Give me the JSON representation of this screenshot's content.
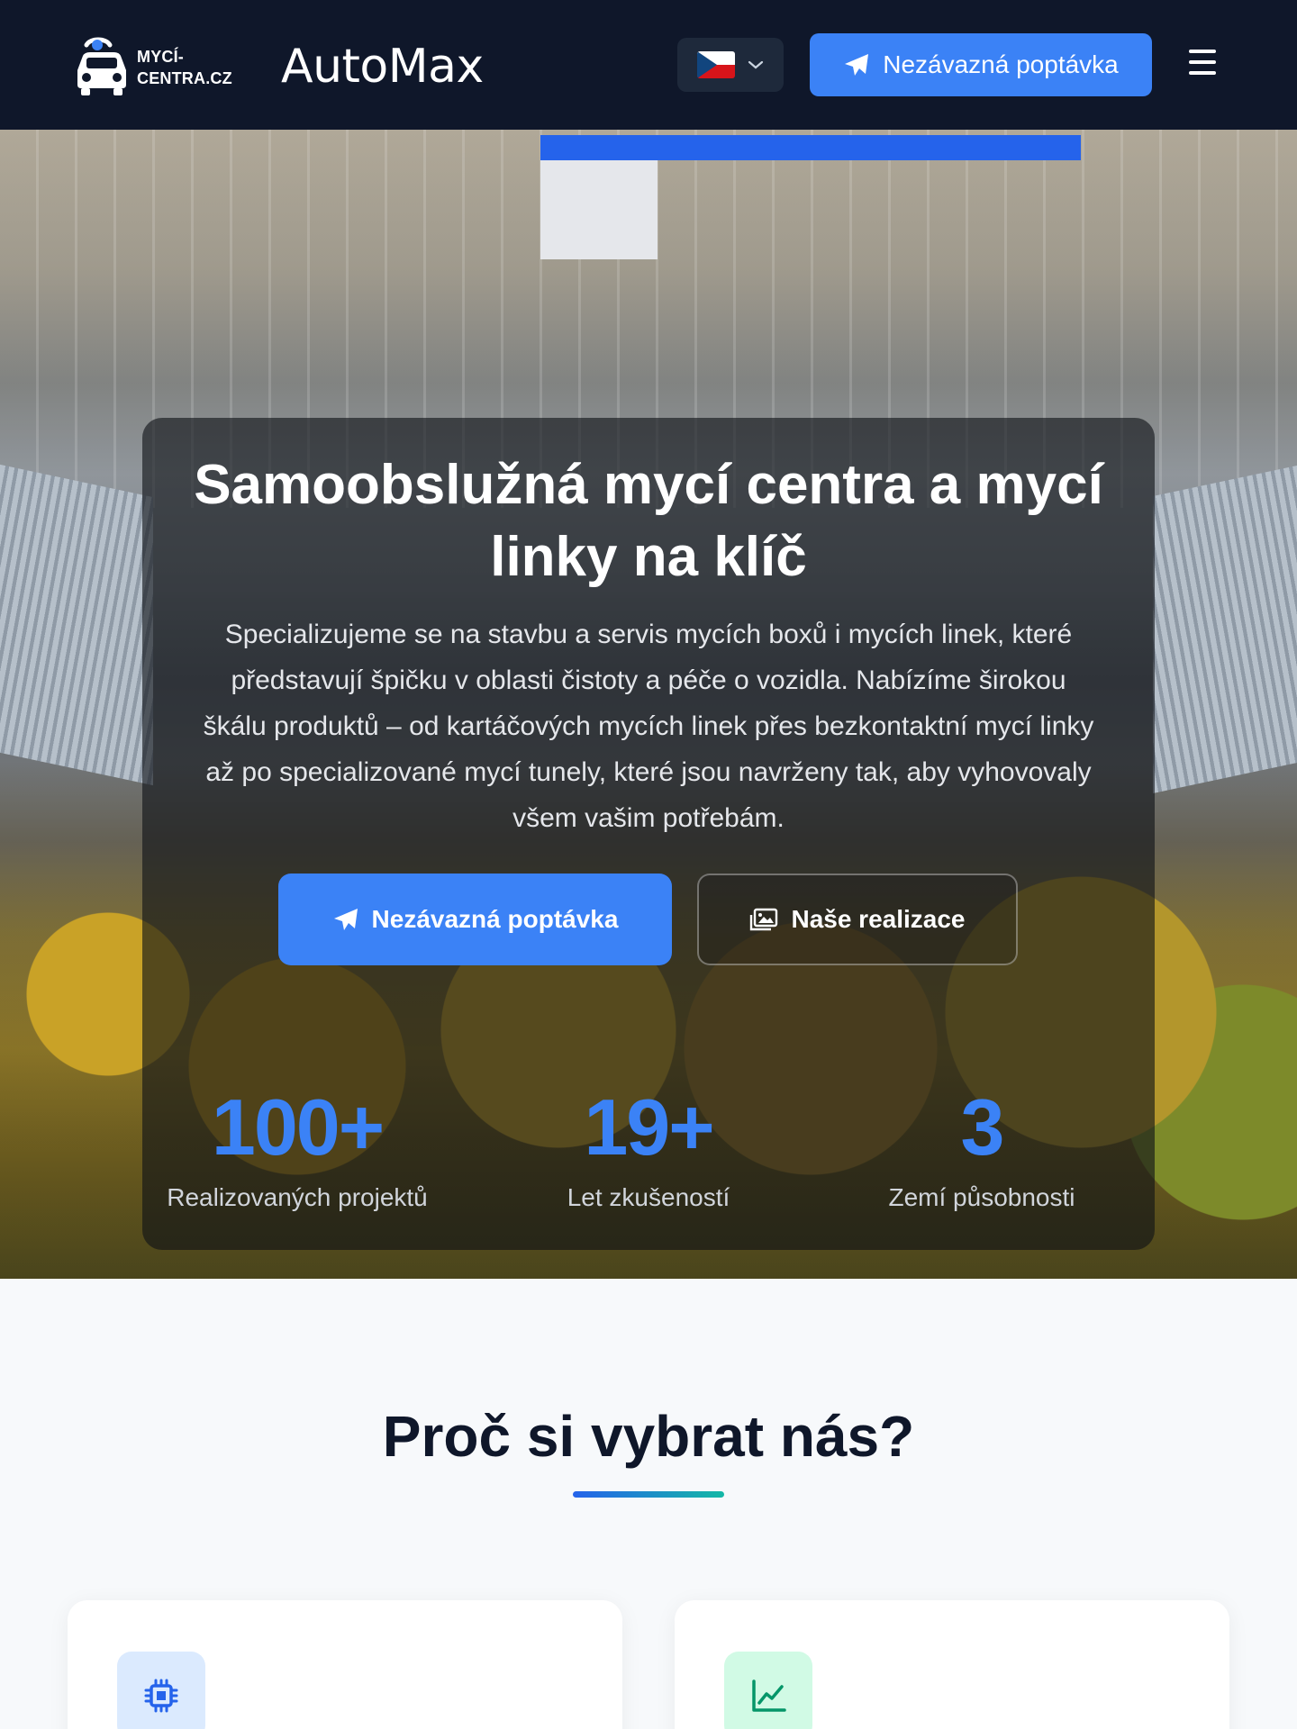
{
  "header": {
    "brand_mycicentra_line1": "MYCÍ-",
    "brand_mycicentra_line2": "CENTRA.CZ",
    "brand_automax": "AutoMax",
    "language": "cs",
    "cta_label": "Nezávazná poptávka"
  },
  "hero": {
    "title": "Samoobslužná mycí centra a mycí linky na klíč",
    "description": "Specializujeme se na stavbu a servis mycích boxů i mycích linek, které představují špičku v oblasti čistoty a péče o vozidla. Nabízíme širokou škálu produktů – od kartáčových mycích linek přes bezkontaktní mycí linky až po specializované mycí tunely, které jsou navrženy tak, aby vyhovovaly všem vašim potřebám.",
    "primary_button": "Nezávazná poptávka",
    "secondary_button": "Naše realizace",
    "stats": [
      {
        "value": "100+",
        "label": "Realizovaných projektů"
      },
      {
        "value": "19+",
        "label": "Let zkušeností"
      },
      {
        "value": "3",
        "label": "Zemí působnosti"
      }
    ]
  },
  "why": {
    "title": "Proč si vybrat nás?",
    "cards": [
      {
        "icon": "chip-icon",
        "accent": "#2563eb"
      },
      {
        "icon": "chart-line-icon",
        "accent": "#059669"
      }
    ]
  },
  "colors": {
    "header_bg": "#0f172a",
    "accent_blue": "#3b82f6",
    "accent_teal": "#14b8a6",
    "page_bg": "#f7f9fb"
  }
}
